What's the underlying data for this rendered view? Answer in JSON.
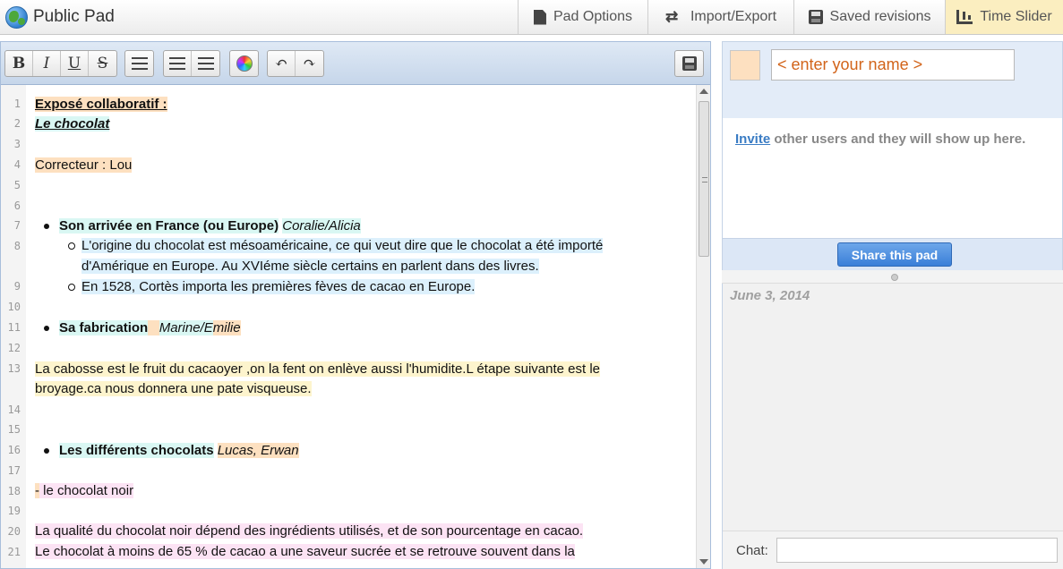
{
  "app": {
    "title": "Public Pad"
  },
  "topbar": {
    "buttons": [
      {
        "label": "Pad Options",
        "icon": "document-icon"
      },
      {
        "label": "Import/Export",
        "icon": "swap-arrows-icon"
      },
      {
        "label": "Saved revisions",
        "icon": "disk-icon"
      },
      {
        "label": "Time Slider",
        "icon": "time-slider-icon",
        "active": true
      }
    ],
    "active_color": "#fbeec0"
  },
  "toolbar": {
    "bold": "B",
    "italic": "I",
    "underline": "U",
    "strike": "S",
    "undo": "↶",
    "redo": "↷"
  },
  "editor": {
    "line_numbers": [
      "1",
      "2",
      "3",
      "4",
      "5",
      "6",
      "7",
      "8",
      "",
      "9",
      "10",
      "11",
      "12",
      "13",
      "",
      "14",
      "15",
      "16",
      "17",
      "18",
      "19",
      "20",
      "21"
    ],
    "title1": "Exposé collaboratif :",
    "title2": "Le chocolat",
    "correcteur": "Correcteur : Lou",
    "b1_head": "Son arrivée en France (ou Europe)",
    "b1_authors": "Coralie/Alicia",
    "b1_sub1_l1": "L'origine du chocolat est mésoaméricaine, ce qui veut dire que le chocolat a été importé",
    "b1_sub1_l2": "d'Amérique en Europe. Au XVIéme siècle certains en parlent dans des livres.",
    "b1_sub2": "En 1528, Cortès importa les premières fèves de cacao en Europe.",
    "b2_head": "Sa fabrication",
    "b2_authors_a": "Marine/E",
    "b2_authors_b": "milie",
    "p1_l1": "La cabosse est le fruit du cacaoyer ,on la fent on enlève aussi l'humidite.L étape suivante est le",
    "p1_l2": "broyage.ca nous donnera une pate visqueuse.",
    "b3_head": "Les différents chocolats",
    "b3_authors": "Lucas, Erwan",
    "noir_dash": "-",
    "noir": " le chocolat noir",
    "p2_l1": "La qualité du chocolat noir dépend des ingrédients utilisés, et de son pourcentage en cacao.",
    "p2_l2": "Le chocolat à moins de 65 % de cacao a une saveur sucrée et se retrouve souvent dans  la"
  },
  "users": {
    "name_placeholder": "< enter your name >",
    "invite_link": "Invite",
    "invite_rest": " other users and they will show up here.",
    "share_label": "Share this pad",
    "user_color": "#fde0c0"
  },
  "chat": {
    "date": "June 3, 2014",
    "label": "Chat:"
  }
}
